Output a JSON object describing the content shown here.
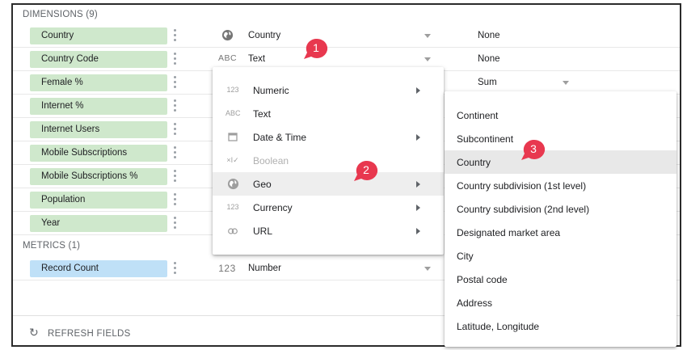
{
  "dimensions_header": "DIMENSIONS (9)",
  "metrics_header": "METRICS (1)",
  "dimensions": [
    {
      "name": "Country",
      "type_icon": "globe-icon",
      "type_icon_text": "",
      "type": "Country",
      "aggregation": "None"
    },
    {
      "name": "Country Code",
      "type_icon": "text-type-icon",
      "type_icon_text": "ABC",
      "type": "Text",
      "aggregation": "None"
    },
    {
      "name": "Female %",
      "aggregation": "Sum"
    },
    {
      "name": "Internet %"
    },
    {
      "name": "Internet Users"
    },
    {
      "name": "Mobile Subscriptions"
    },
    {
      "name": "Mobile Subscriptions %"
    },
    {
      "name": "Population"
    },
    {
      "name": "Year"
    }
  ],
  "metrics": [
    {
      "name": "Record Count",
      "type_icon_text": "123",
      "type": "Number"
    }
  ],
  "refresh_label": "REFRESH FIELDS",
  "type_menu": [
    {
      "icon": "123",
      "label": "Numeric",
      "submenu": true,
      "disabled": false
    },
    {
      "icon": "ABC",
      "label": "Text",
      "submenu": false,
      "disabled": false
    },
    {
      "icon": "calendar",
      "label": "Date & Time",
      "submenu": true,
      "disabled": false
    },
    {
      "icon": "×I✓",
      "label": "Boolean",
      "submenu": false,
      "disabled": true
    },
    {
      "icon": "globe",
      "label": "Geo",
      "submenu": true,
      "disabled": false,
      "active": true
    },
    {
      "icon": "123",
      "label": "Currency",
      "submenu": true,
      "disabled": false
    },
    {
      "icon": "link",
      "label": "URL",
      "submenu": true,
      "disabled": false
    }
  ],
  "geo_menu": [
    {
      "label": "Continent"
    },
    {
      "label": "Subcontinent"
    },
    {
      "label": "Country",
      "active": true
    },
    {
      "label": "Country subdivision (1st level)"
    },
    {
      "label": "Country subdivision (2nd level)"
    },
    {
      "label": "Designated market area"
    },
    {
      "label": "City"
    },
    {
      "label": "Postal code"
    },
    {
      "label": "Address"
    },
    {
      "label": "Latitude, Longitude"
    }
  ],
  "callouts": [
    "1",
    "2",
    "3"
  ],
  "colors": {
    "dimension_chip": "#cfe8cc",
    "metric_chip": "#bfe0f7",
    "callout": "#e8384f",
    "menu_highlight": "#eeeeee"
  }
}
